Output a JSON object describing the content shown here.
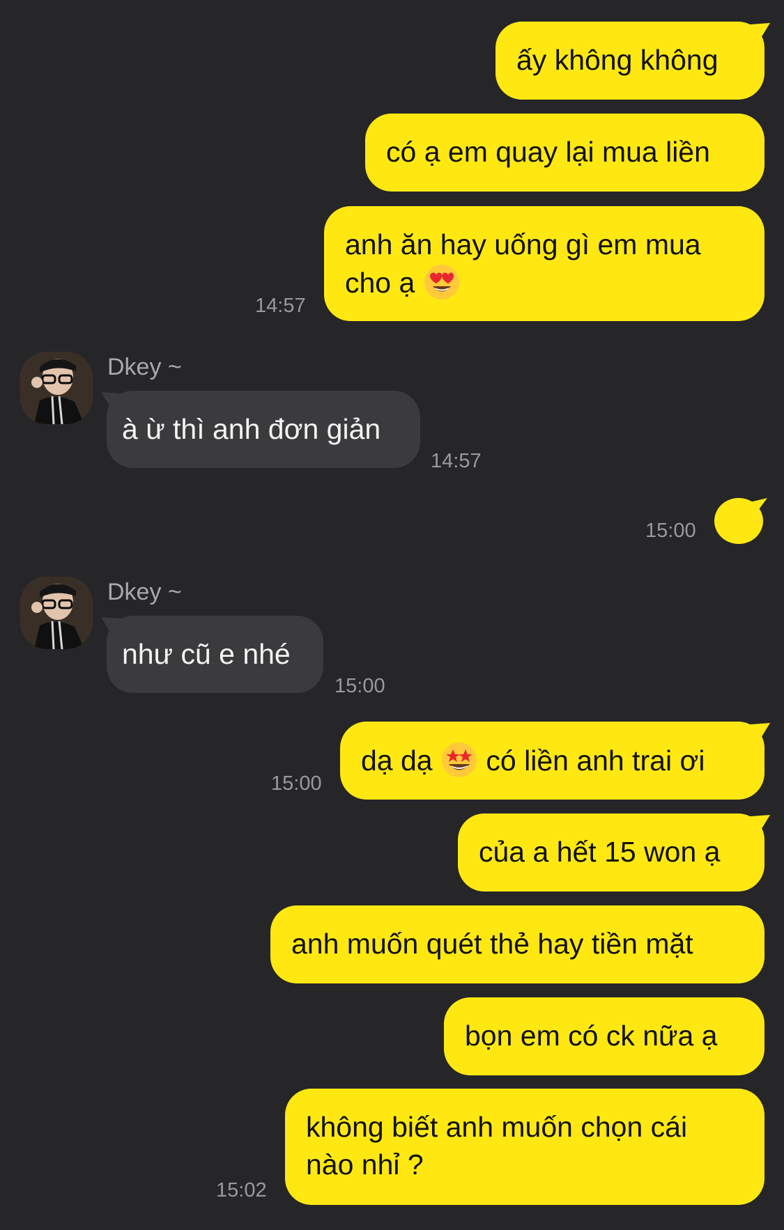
{
  "messages": [
    {
      "text": "ấy không không"
    },
    {
      "text": "có ạ em quay lại mua liền"
    },
    {
      "text_line1": "anh ăn hay uống gì em mua",
      "text_line2": "cho ạ",
      "time": "14:57"
    },
    {
      "sender": "Dkey ~",
      "text": "à ừ thì anh đơn giản",
      "time": "14:57"
    },
    {
      "time": "15:00"
    },
    {
      "sender": "Dkey ~",
      "text": "như cũ e nhé",
      "time": "15:00"
    },
    {
      "text_before": "dạ dạ",
      "text_after": "có liền anh trai ơi",
      "time": "15:00"
    },
    {
      "text": "của a hết 15 won ạ"
    },
    {
      "text": "anh muốn quét thẻ hay tiền mặt"
    },
    {
      "text": "bọn em có ck nữa ạ"
    },
    {
      "text_line1": "không biết anh muốn chọn cái",
      "text_line2": "nào nhỉ ?",
      "time": "15:02"
    }
  ],
  "icons": {
    "heart_eyes": "heart-eyes-emoji",
    "star_struck": "star-struck-emoji",
    "sticker": "yellow-bubble-sticker"
  },
  "colors": {
    "background": "#262628",
    "outgoing_bubble": "#FFE812",
    "incoming_bubble": "#3b3b3d",
    "timestamp": "#9a9a9e"
  }
}
